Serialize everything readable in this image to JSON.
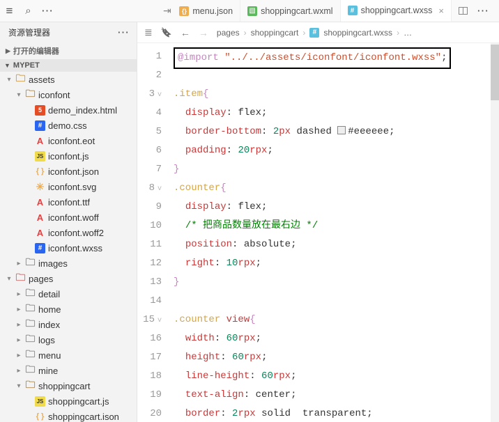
{
  "titlebar": {
    "tabs": [
      {
        "icon": "jsonfile",
        "label": "menu.json"
      },
      {
        "icon": "greenfile",
        "label": "shoppingcart.wxml"
      },
      {
        "icon": "bluefile",
        "label": "shoppingcart.wxss",
        "active": true
      }
    ]
  },
  "sidebar": {
    "title": "资源管理器",
    "opened_editors": "打开的编辑器",
    "project": "MYPET",
    "tree": [
      {
        "d": 0,
        "t": "folder-orange",
        "tw": "open",
        "name": "assets"
      },
      {
        "d": 1,
        "t": "folder",
        "tw": "open",
        "name": "iconfont"
      },
      {
        "d": 2,
        "t": "html",
        "name": "demo_index.html"
      },
      {
        "d": 2,
        "t": "css",
        "name": "demo.css"
      },
      {
        "d": 2,
        "t": "a",
        "name": "iconfont.eot"
      },
      {
        "d": 2,
        "t": "js",
        "name": "iconfont.js"
      },
      {
        "d": 2,
        "t": "json",
        "name": "iconfont.json"
      },
      {
        "d": 2,
        "t": "svg",
        "name": "iconfont.svg"
      },
      {
        "d": 2,
        "t": "a",
        "name": "iconfont.ttf"
      },
      {
        "d": 2,
        "t": "a",
        "name": "iconfont.woff"
      },
      {
        "d": 2,
        "t": "a",
        "name": "iconfont.woff2"
      },
      {
        "d": 2,
        "t": "css",
        "name": "iconfont.wxss"
      },
      {
        "d": 1,
        "t": "gray",
        "tw": "closed",
        "name": "images"
      },
      {
        "d": 0,
        "t": "folder-red",
        "tw": "open",
        "name": "pages"
      },
      {
        "d": 1,
        "t": "gray",
        "tw": "closed",
        "name": "detail"
      },
      {
        "d": 1,
        "t": "gray",
        "tw": "closed",
        "name": "home"
      },
      {
        "d": 1,
        "t": "gray",
        "tw": "closed",
        "name": "index"
      },
      {
        "d": 1,
        "t": "gray",
        "tw": "closed",
        "name": "logs"
      },
      {
        "d": 1,
        "t": "gray",
        "tw": "closed",
        "name": "menu"
      },
      {
        "d": 1,
        "t": "gray",
        "tw": "closed",
        "name": "mine"
      },
      {
        "d": 1,
        "t": "folder",
        "tw": "open",
        "name": "shoppingcart"
      },
      {
        "d": 2,
        "t": "js",
        "name": "shoppingcart.js"
      },
      {
        "d": 2,
        "t": "json",
        "name": "shoppingcart.ison"
      }
    ]
  },
  "breadcrumb": {
    "seg1": "pages",
    "seg2": "shoppingcart",
    "seg3": "shoppingcart.wxss",
    "more": "…"
  },
  "code": {
    "lines": [
      {
        "n": 1,
        "fold": "",
        "highlight": true,
        "tokens": [
          [
            "keyword",
            "@import "
          ],
          [
            "string",
            "\"../../assets/iconfont/iconfont.wxss\""
          ],
          [
            "punc",
            ";"
          ]
        ]
      },
      {
        "n": 2,
        "tokens": []
      },
      {
        "n": 3,
        "fold": "v",
        "tokens": [
          [
            "selector",
            ".item"
          ],
          [
            "brace",
            "{"
          ]
        ]
      },
      {
        "n": 4,
        "tokens": [
          [
            "indent",
            "  "
          ],
          [
            "prop",
            "display"
          ],
          [
            "punc",
            ": "
          ],
          [
            "val",
            "flex"
          ],
          [
            "punc",
            ";"
          ]
        ]
      },
      {
        "n": 5,
        "tokens": [
          [
            "indent",
            "  "
          ],
          [
            "prop",
            "border-bottom"
          ],
          [
            "punc",
            ": "
          ],
          [
            "num",
            "2"
          ],
          [
            "unit",
            "px "
          ],
          [
            "val",
            "dashed "
          ],
          [
            "swatch",
            "#eeeeee"
          ],
          [
            "val",
            "#eeeeee"
          ],
          [
            "punc",
            ";"
          ]
        ]
      },
      {
        "n": 6,
        "tokens": [
          [
            "indent",
            "  "
          ],
          [
            "prop",
            "padding"
          ],
          [
            "punc",
            ": "
          ],
          [
            "num",
            "20"
          ],
          [
            "unit",
            "rpx"
          ],
          [
            "punc",
            ";"
          ]
        ]
      },
      {
        "n": 7,
        "tokens": [
          [
            "brace",
            "}"
          ]
        ]
      },
      {
        "n": 8,
        "fold": "v",
        "tokens": [
          [
            "selector",
            ".counter"
          ],
          [
            "brace",
            "{"
          ]
        ]
      },
      {
        "n": 9,
        "tokens": [
          [
            "indent",
            "  "
          ],
          [
            "prop",
            "display"
          ],
          [
            "punc",
            ": "
          ],
          [
            "val",
            "flex"
          ],
          [
            "punc",
            ";"
          ]
        ]
      },
      {
        "n": 10,
        "tokens": [
          [
            "indent",
            "  "
          ],
          [
            "comment",
            "/* 把商品数量放在最右边 */"
          ]
        ]
      },
      {
        "n": 11,
        "tokens": [
          [
            "indent",
            "  "
          ],
          [
            "prop",
            "position"
          ],
          [
            "punc",
            ": "
          ],
          [
            "val",
            "absolute"
          ],
          [
            "punc",
            ";"
          ]
        ]
      },
      {
        "n": 12,
        "tokens": [
          [
            "indent",
            "  "
          ],
          [
            "prop",
            "right"
          ],
          [
            "punc",
            ": "
          ],
          [
            "num",
            "10"
          ],
          [
            "unit",
            "rpx"
          ],
          [
            "punc",
            ";"
          ]
        ]
      },
      {
        "n": 13,
        "tokens": [
          [
            "brace",
            "}"
          ]
        ]
      },
      {
        "n": 14,
        "tokens": []
      },
      {
        "n": 15,
        "fold": "v",
        "tokens": [
          [
            "selector",
            ".counter "
          ],
          [
            "unit",
            "view"
          ],
          [
            "brace",
            "{"
          ]
        ]
      },
      {
        "n": 16,
        "tokens": [
          [
            "indent",
            "  "
          ],
          [
            "prop",
            "width"
          ],
          [
            "punc",
            ": "
          ],
          [
            "num",
            "60"
          ],
          [
            "unit",
            "rpx"
          ],
          [
            "punc",
            ";"
          ]
        ]
      },
      {
        "n": 17,
        "tokens": [
          [
            "indent",
            "  "
          ],
          [
            "prop",
            "height"
          ],
          [
            "punc",
            ": "
          ],
          [
            "num",
            "60"
          ],
          [
            "unit",
            "rpx"
          ],
          [
            "punc",
            ";"
          ]
        ]
      },
      {
        "n": 18,
        "tokens": [
          [
            "indent",
            "  "
          ],
          [
            "prop",
            "line-height"
          ],
          [
            "punc",
            ": "
          ],
          [
            "num",
            "60"
          ],
          [
            "unit",
            "rpx"
          ],
          [
            "punc",
            ";"
          ]
        ]
      },
      {
        "n": 19,
        "tokens": [
          [
            "indent",
            "  "
          ],
          [
            "prop",
            "text-align"
          ],
          [
            "punc",
            ": "
          ],
          [
            "val",
            "center"
          ],
          [
            "punc",
            ";"
          ]
        ]
      },
      {
        "n": 20,
        "tokens": [
          [
            "indent",
            "  "
          ],
          [
            "prop",
            "border"
          ],
          [
            "punc",
            ": "
          ],
          [
            "num",
            "2"
          ],
          [
            "unit",
            "rpx "
          ],
          [
            "val",
            "solid  transparent"
          ],
          [
            "punc",
            ";"
          ]
        ]
      }
    ]
  }
}
